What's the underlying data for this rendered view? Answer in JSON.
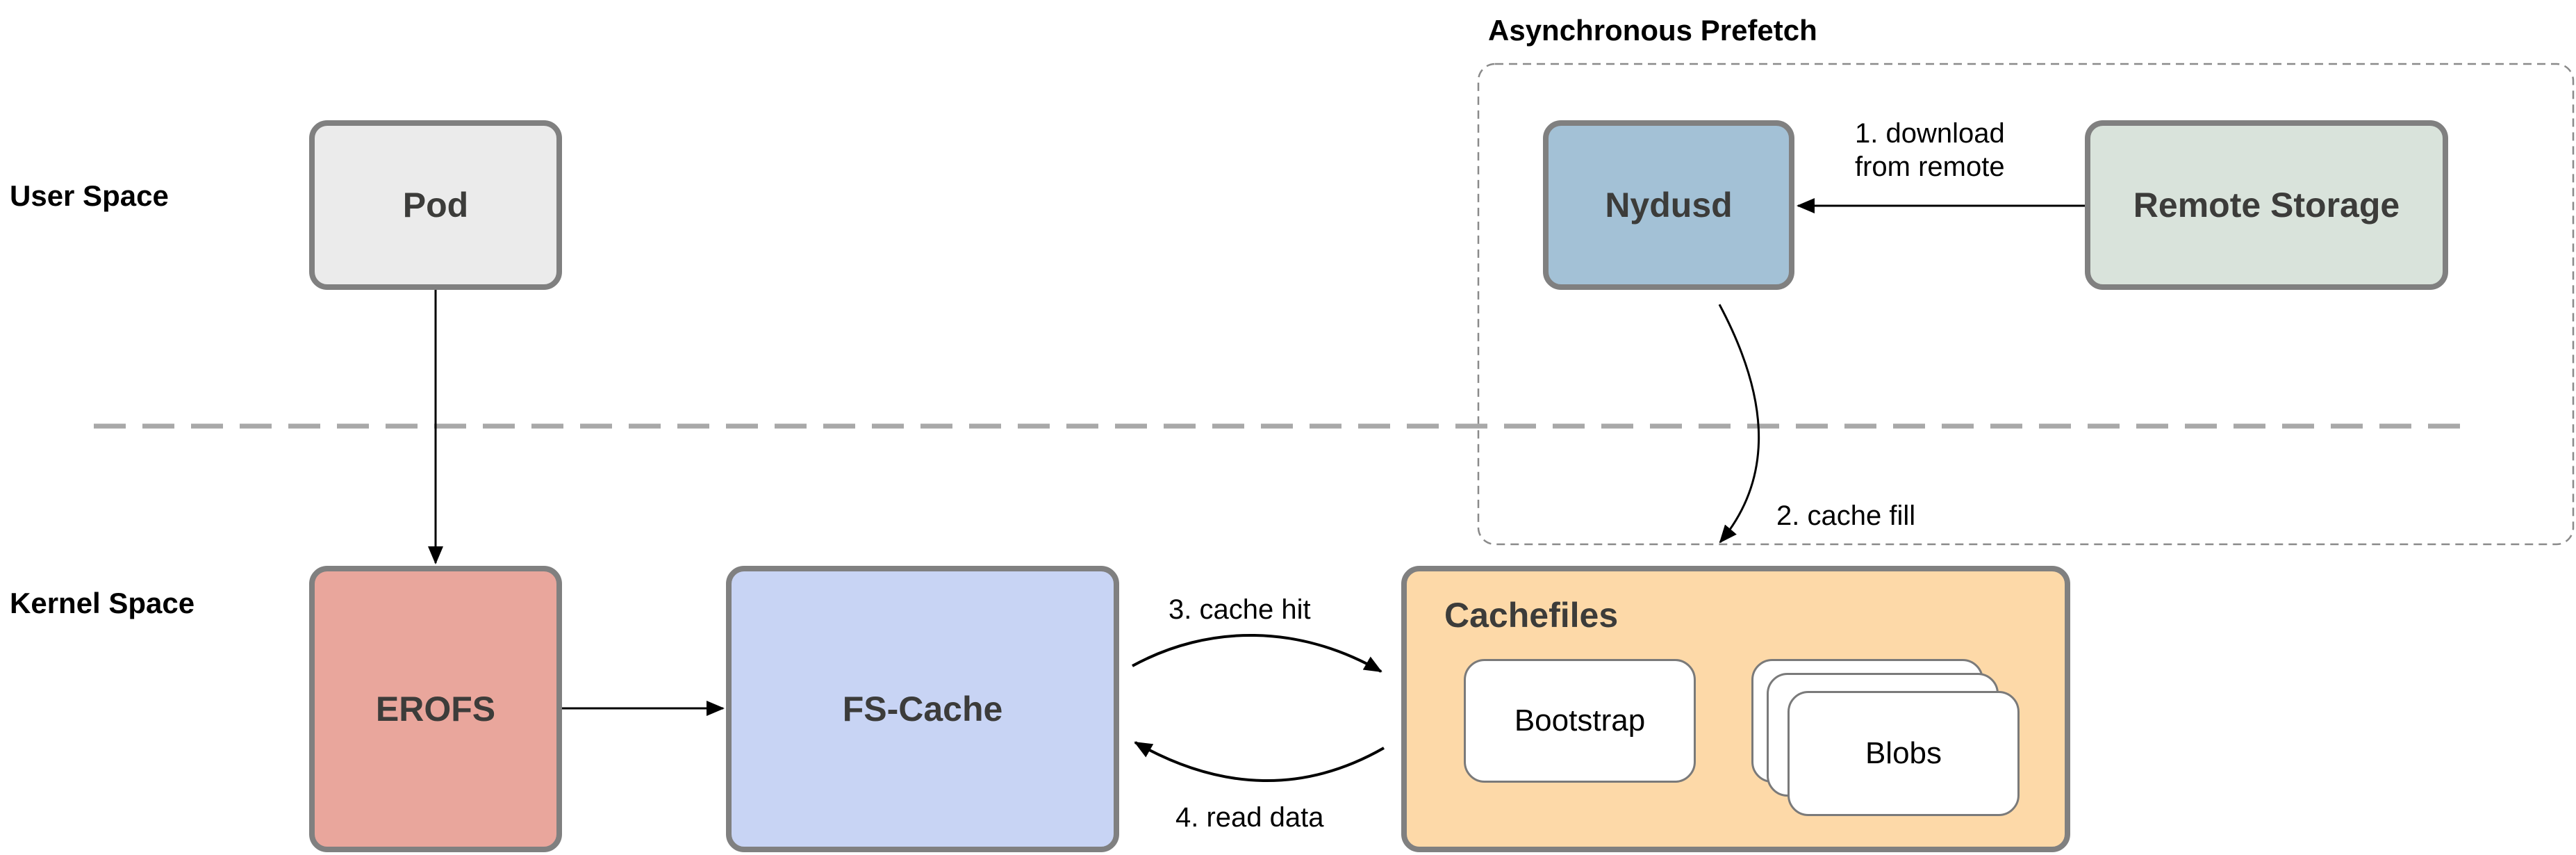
{
  "diagram": {
    "regions": {
      "user_space": "User Space",
      "kernel_space": "Kernel Space"
    },
    "group": {
      "title": "Asynchronous Prefetch"
    },
    "nodes": {
      "pod": {
        "label": "Pod",
        "color": "#ebebeb"
      },
      "nydusd": {
        "label": "Nydusd",
        "color": "#a3c1d6"
      },
      "remote_storage": {
        "label": "Remote Storage",
        "color": "#d9e3db"
      },
      "erofs": {
        "label": "EROFS",
        "color": "#e9a69c"
      },
      "fscache": {
        "label": "FS-Cache",
        "color": "#c8d4f4"
      },
      "cachefiles": {
        "label": "Cachefiles",
        "color": "#fdd9a8"
      },
      "bootstrap": {
        "label": "Bootstrap"
      },
      "blobs": {
        "label": "Blobs"
      }
    },
    "edges": {
      "download_line1": "1. download",
      "download_line2": "from remote",
      "cache_fill": "2. cache fill",
      "cache_hit": "3. cache hit",
      "read_data": "4. read data"
    }
  }
}
